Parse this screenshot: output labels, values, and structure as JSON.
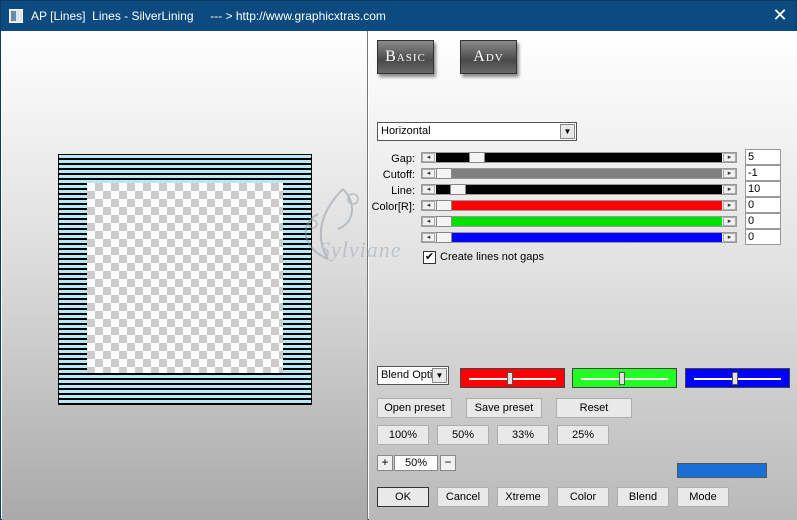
{
  "window": {
    "title": "AP [Lines]  Lines - SilverLining     --- > http://www.graphicxtras.com",
    "close_glyph": "✕"
  },
  "mode_tabs": {
    "basic": "Basic",
    "adv": "Adv"
  },
  "direction": {
    "selected": "Horizontal"
  },
  "params": [
    {
      "label": "Gap:",
      "value": "5",
      "track_color": "#000000",
      "level": 0.12
    },
    {
      "label": "Cutoff:",
      "value": "-1",
      "track_color": "#808080",
      "level": 0.0
    },
    {
      "label": "Line:",
      "value": "10",
      "track_color": "#000000",
      "level": 0.05
    },
    {
      "label": "Color[R]:",
      "value": "0",
      "track_color": "#ff0000",
      "level": 0.0
    },
    {
      "label": "",
      "value": "0",
      "track_color": "#00e000",
      "level": 0.0
    },
    {
      "label": "",
      "value": "0",
      "track_color": "#0000ff",
      "level": 0.0
    }
  ],
  "create_lines": {
    "label": "Create lines not gaps",
    "checked": true,
    "check_glyph": "✔"
  },
  "blend_options": {
    "selected": "Blend Optio"
  },
  "color_sliders": [
    {
      "color": "#ff0000",
      "level": 0.5
    },
    {
      "color": "#22ff22",
      "level": 0.5
    },
    {
      "color": "#0000ff",
      "level": 0.5
    }
  ],
  "preset_buttons": {
    "open": "Open preset",
    "save": "Save preset",
    "reset": "Reset"
  },
  "zoom_buttons": [
    "100%",
    "50%",
    "33%",
    "25%"
  ],
  "zoom": {
    "plus": "+",
    "value": "50%",
    "minus": "−"
  },
  "swatch_color": "#1a6fd6",
  "bottom_buttons": {
    "ok": "OK",
    "cancel": "Cancel",
    "xtreme": "Xtreme",
    "color": "Color",
    "blend": "Blend",
    "mode": "Mode"
  },
  "watermark": "Sylviane"
}
